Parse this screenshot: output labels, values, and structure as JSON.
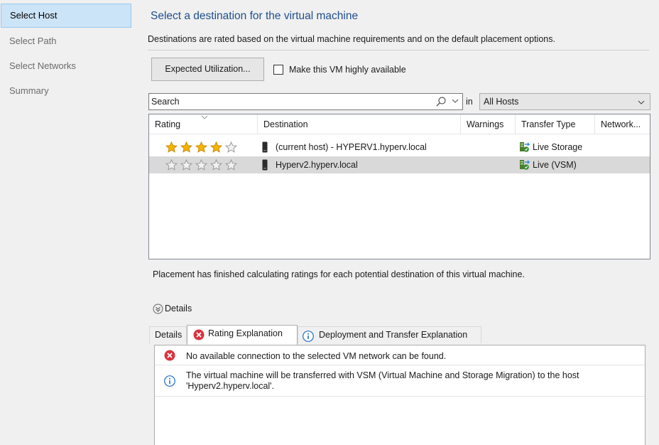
{
  "nav": {
    "items": [
      {
        "label": "Select Host",
        "active": true
      },
      {
        "label": "Select Path",
        "active": false
      },
      {
        "label": "Select Networks",
        "active": false
      },
      {
        "label": "Summary",
        "active": false
      }
    ]
  },
  "header": {
    "title": "Select a destination for the virtual machine",
    "description": "Destinations are rated based on the virtual machine requirements and on the default placement options."
  },
  "toolbar": {
    "expected_utilization_label": "Expected Utilization...",
    "highly_available_label": "Make this VM highly available",
    "highly_available_checked": false
  },
  "search": {
    "placeholder": "Search",
    "in_label": "in",
    "scope_value": "All Hosts"
  },
  "grid": {
    "columns": [
      "Rating",
      "Destination",
      "Warnings",
      "Transfer Type",
      "Network..."
    ],
    "rows": [
      {
        "rating": 4,
        "max_rating": 5,
        "destination": "(current host) - HYPERV1.hyperv.local",
        "warnings": "",
        "transfer_type": "Live Storage",
        "selected": false
      },
      {
        "rating": 0,
        "max_rating": 5,
        "destination": "Hyperv2.hyperv.local",
        "warnings": "",
        "transfer_type": "Live (VSM)",
        "selected": true
      }
    ]
  },
  "status_message": "Placement has finished calculating ratings for each potential destination of this virtual machine.",
  "details_toggle_label": "Details",
  "tabs": [
    {
      "label": "Details",
      "icon": "",
      "active": false
    },
    {
      "label": "Rating Explanation",
      "icon": "error-icon",
      "active": true
    },
    {
      "label": "Deployment and Transfer Explanation",
      "icon": "info-icon",
      "active": false
    }
  ],
  "messages": [
    {
      "icon": "error-icon",
      "text": "No available connection to the selected VM network can be found."
    },
    {
      "icon": "info-icon",
      "text": "The virtual machine will be transferred with VSM (Virtual Machine and Storage Migration) to the host 'Hyperv2.hyperv.local'."
    }
  ],
  "colors": {
    "title": "#1f4e8c",
    "nav_active_bg": "#cce4f7",
    "selected_row_bg": "#d9d9d9",
    "star_filled": "#f5b400",
    "error_red": "#d9333f",
    "info_blue": "#1e6fc8"
  }
}
